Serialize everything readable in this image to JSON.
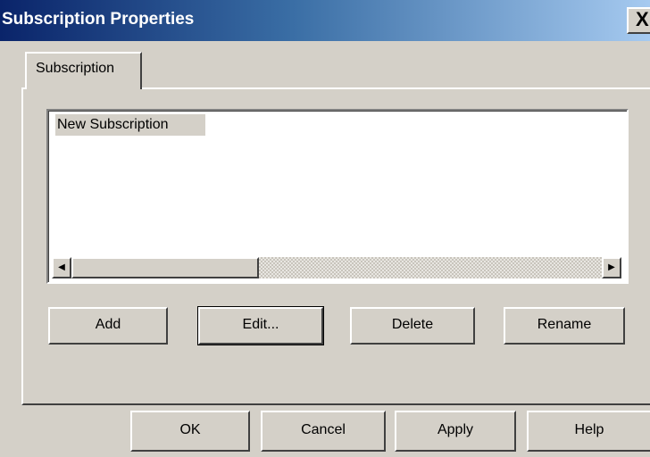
{
  "window": {
    "title": "Subscription Properties",
    "close_glyph": "X"
  },
  "tabs": [
    {
      "label": "Subscription",
      "selected": true
    }
  ],
  "subscription_list": {
    "items": [
      {
        "label": "New Subscription",
        "selected": true
      }
    ],
    "scroll_left_glyph": "◀",
    "scroll_right_glyph": "▶"
  },
  "list_actions": {
    "add_label": "Add",
    "edit_label": "Edit...",
    "delete_label": "Delete",
    "rename_label": "Rename"
  },
  "dialog_actions": {
    "ok_label": "OK",
    "cancel_label": "Cancel",
    "apply_label": "Apply",
    "help_label": "Help"
  },
  "colors": {
    "face": "#d4d0c8",
    "title_start": "#0a246a",
    "title_end": "#a6caf0"
  }
}
